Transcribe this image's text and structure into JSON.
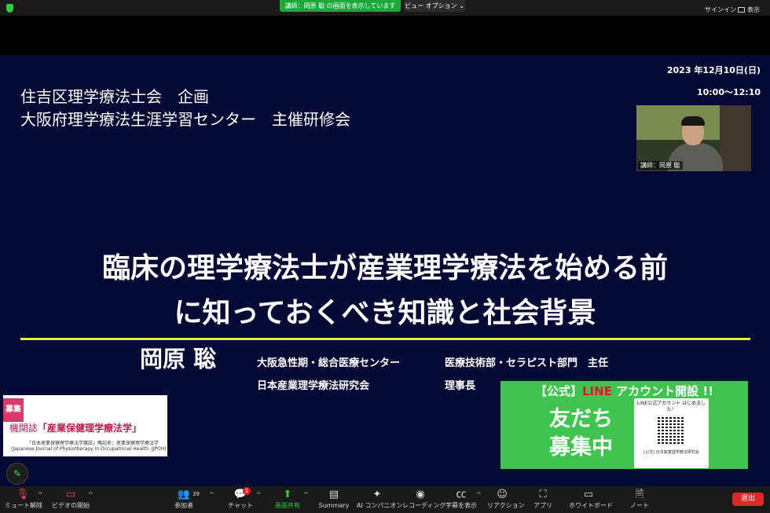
{
  "top_bar": {
    "share_banner": "講師：岡原 聡 の画面を表示しています",
    "view_options": "ビュー オプション",
    "signin": "サインイン",
    "display": "表示"
  },
  "slide": {
    "org_line1": "住吉区理学療法士会　企画",
    "org_line2": "大阪府理学療法生涯学習センター　主催研修会",
    "date": "2023 年12月10日(日)",
    "time": "10:00〜12:10",
    "title_line1": "臨床の理学療法士が産業理学療法を始める前",
    "title_line2": "に知っておくべき知識と社会背景",
    "presenter": "岡原 聡",
    "affiliation1_org": "大阪急性期・総合医療センター",
    "affiliation1_role": "医療技術部・セラピスト部門　主任",
    "affiliation2_org": "日本産業理学療法研究会",
    "affiliation2_role": "理事長",
    "journal": {
      "badge": "募集",
      "prefix": "機関誌",
      "name": "「産業保健理学療法学」",
      "line1": "「日本産業保健理学療法学雑誌」略記名：産業保健理学療法学",
      "line2": "(Japanese Journal of Physiotherapy in Occupational Health: JJPOH)"
    },
    "line_ad": {
      "header_prefix": "【公式】",
      "header_line": "LINE",
      "header_suffix": " アカウント開設 !!",
      "big1": "友だち",
      "big2": "募集中",
      "card_title": "LINE公式アカウント はじめました！",
      "card_footer": "[公式] 日本産業理学療法研究会"
    }
  },
  "speaker_video": {
    "name": "講師：岡原 聡"
  },
  "toolbar": {
    "mute": "ミュート解除",
    "video": "ビデオの開始",
    "participants": "参加者",
    "participants_count": "39",
    "chat": "チャット",
    "chat_badge": "1",
    "share": "画面共有",
    "summary": "Summary",
    "ai": "AI コンパニオン",
    "record": "レコーディング",
    "captions": "字幕を表示",
    "reactions": "リアクション",
    "apps": "アプリ",
    "whiteboard": "ホワイトボード",
    "notes": "ノート",
    "leave": "退出"
  }
}
